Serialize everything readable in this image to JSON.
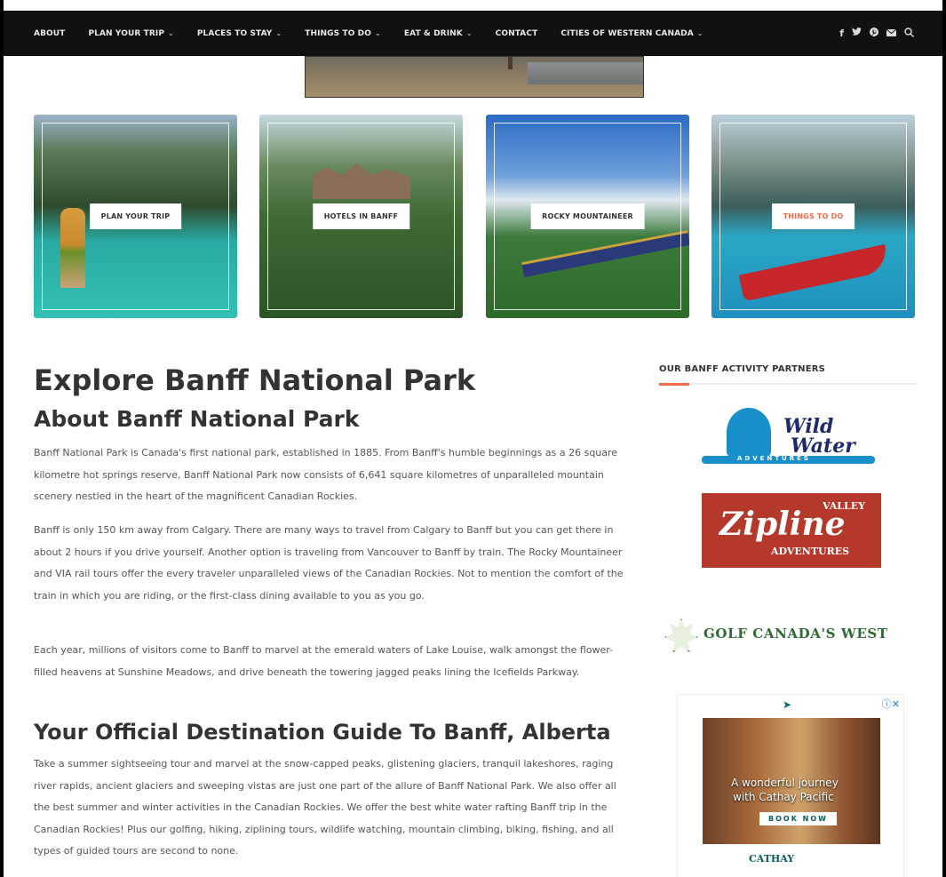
{
  "nav": {
    "items": [
      {
        "label": "ABOUT",
        "dropdown": false
      },
      {
        "label": "PLAN YOUR TRIP",
        "dropdown": true
      },
      {
        "label": "PLACES TO STAY",
        "dropdown": true
      },
      {
        "label": "THINGS TO DO",
        "dropdown": true
      },
      {
        "label": "EAT & DRINK",
        "dropdown": true
      },
      {
        "label": "CONTACT",
        "dropdown": false
      },
      {
        "label": "CITIES OF WESTERN CANADA",
        "dropdown": true
      }
    ],
    "caret": "⌄",
    "social": [
      "facebook-icon",
      "twitter-icon",
      "pinterest-icon",
      "email-icon",
      "search-icon"
    ]
  },
  "tiles": [
    {
      "label": "PLAN YOUR TRIP"
    },
    {
      "label": "HOTELS IN BANFF"
    },
    {
      "label": "ROCKY MOUNTAINEER"
    },
    {
      "label": "THINGS TO DO"
    }
  ],
  "main": {
    "title": "Explore Banff National Park",
    "about_heading": "About Banff National Park",
    "paragraphs": [
      "Banff National Park is Canada's first national park, established in 1885. From Banff's humble beginnings as a 26 square kilometre hot springs reserve, Banff National Park now consists of 6,641 square kilometres of unparalleled mountain scenery nestled in the heart of the magnificent Canadian Rockies.",
      "Banff is only 150 km away from Calgary. There are many ways to travel from Calgary to Banff but you can get there in about 2 hours if you drive yourself. Another option is traveling from Vancouver to Banff by train. The Rocky Mountaineer and VIA rail tours offer the every traveler unparalleled views of the Canadian Rockies. Not to mention the comfort of the train in which you are riding, or the first-class dining available to you as you go.",
      "Each year, millions of visitors come to Banff to marvel at the emerald waters of Lake Louise, walk amongst the flower-filled heavens at Sunshine Meadows, and drive beneath the towering jagged peaks lining the Icefields Parkway.",
      "Take a summer sightseeing tour and marvel at the snow-capped peaks, glistening glaciers, tranquil lakeshores, raging river rapids, ancient glaciers and sweeping vistas are just one part of the allure of Banff National Park. We also offer all the best summer and winter activities in the Canadian Rockies. We offer the best white water rafting Banff trip in the Canadian Rockies! Plus our golfing, hiking, ziplining tours, wildlife watching, mountain climbing, biking, fishing, and all types of guided tours are second to none."
    ],
    "guide_heading": "Your Official Destination Guide To Banff, Alberta"
  },
  "sidebar": {
    "title": "OUR BANFF ACTIVITY PARTNERS",
    "accent_color": "#f26a4b",
    "partners": {
      "wild_water": {
        "line1": "Wild",
        "line2": "Water",
        "tag": "ADVENTURES"
      },
      "zipline": {
        "top": "VALLEY",
        "main": "Zipline",
        "bottom": "ADVENTURES"
      },
      "golf": {
        "name": "GOLF CANADA'S WEST"
      }
    },
    "ad": {
      "headline1": "A wonderful journey",
      "headline2": "with Cathay Pacific",
      "button": "BOOK NOW",
      "brand": "CATHAY",
      "close": "ⓘ✕"
    }
  }
}
